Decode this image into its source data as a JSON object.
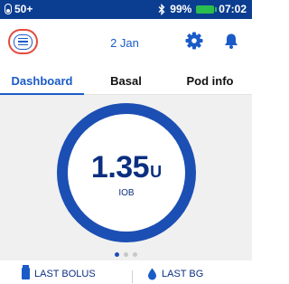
{
  "status_bar": {
    "pod_status": "50+",
    "bluetooth_icon": "bluetooth-icon",
    "battery_percent": "99%",
    "battery_level": 0.99,
    "time": "07:02"
  },
  "header": {
    "menu_icon": "hamburger-menu-icon",
    "date": "2 Jan",
    "settings_icon": "gear-icon",
    "notifications_icon": "bell-icon"
  },
  "tabs": [
    {
      "label": "Dashboard",
      "active": true
    },
    {
      "label": "Basal",
      "active": false
    },
    {
      "label": "Pod info",
      "active": false
    }
  ],
  "iob": {
    "value": "1.35",
    "unit": "U",
    "label": "IOB"
  },
  "pager": {
    "count": 3,
    "active_index": 0
  },
  "bottom": {
    "last_bolus_label": "LAST BOLUS",
    "last_bg_label": "LAST BG"
  },
  "colors": {
    "primary_blue": "#1c4fb4",
    "status_bar": "#0b3d91",
    "highlight_red": "#e34b3c",
    "battery_green": "#2bbd4e"
  }
}
